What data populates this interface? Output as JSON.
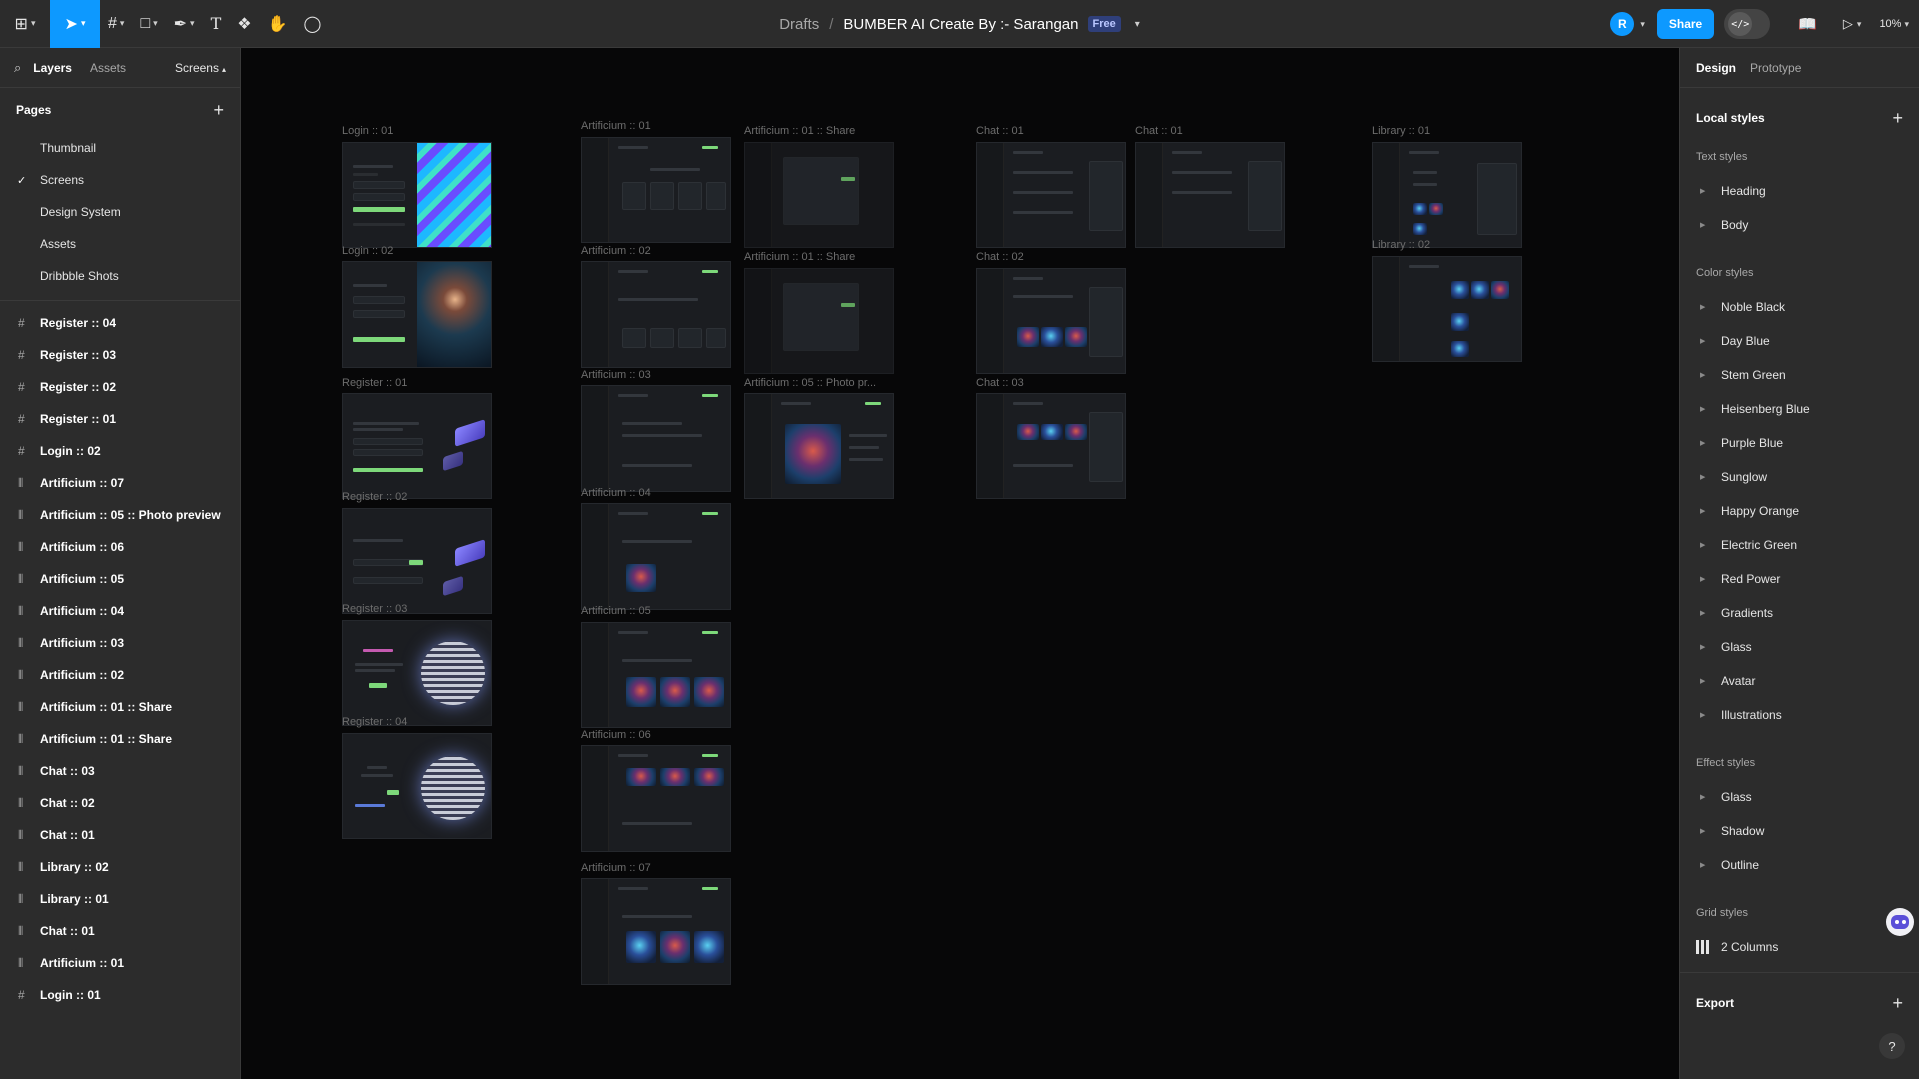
{
  "topbar": {
    "breadcrumb": "Drafts",
    "separator": "/",
    "file_name": "BUMBER AI Create By :- Sarangan",
    "plan_badge": "Free",
    "avatar_initial": "R",
    "share_label": "Share",
    "zoom": "10%",
    "accent_color": "#0d99ff",
    "tools": [
      "main-menu-icon",
      "move-icon",
      "frame-icon",
      "shape-icon",
      "pen-icon",
      "text-icon",
      "components-icon",
      "hand-icon",
      "comment-icon"
    ]
  },
  "left_panel": {
    "tabs": [
      "Layers",
      "Assets"
    ],
    "current_page_selector": "Screens",
    "pages_title": "Pages",
    "pages": [
      {
        "label": "Thumbnail",
        "selected": false
      },
      {
        "label": "Screens",
        "selected": true
      },
      {
        "label": "Design System",
        "selected": false
      },
      {
        "label": "Assets",
        "selected": false
      },
      {
        "label": "Dribbble Shots",
        "selected": false
      }
    ],
    "layers": [
      {
        "label": "Register :: 04",
        "icon": "frame-icon"
      },
      {
        "label": "Register :: 03",
        "icon": "frame-icon"
      },
      {
        "label": "Register :: 02",
        "icon": "frame-icon"
      },
      {
        "label": "Register :: 01",
        "icon": "frame-icon"
      },
      {
        "label": "Login :: 02",
        "icon": "frame-icon"
      },
      {
        "label": "Artificium :: 07",
        "icon": "column-layout-icon"
      },
      {
        "label": "Artificium :: 05 :: Photo preview",
        "icon": "column-layout-icon"
      },
      {
        "label": "Artificium :: 06",
        "icon": "column-layout-icon"
      },
      {
        "label": "Artificium :: 05",
        "icon": "column-layout-icon"
      },
      {
        "label": "Artificium :: 04",
        "icon": "column-layout-icon"
      },
      {
        "label": "Artificium :: 03",
        "icon": "column-layout-icon"
      },
      {
        "label": "Artificium :: 02",
        "icon": "column-layout-icon"
      },
      {
        "label": "Artificium :: 01 :: Share",
        "icon": "column-layout-icon"
      },
      {
        "label": "Artificium :: 01 :: Share",
        "icon": "column-layout-icon"
      },
      {
        "label": "Chat :: 03",
        "icon": "column-layout-icon"
      },
      {
        "label": "Chat :: 02",
        "icon": "column-layout-icon"
      },
      {
        "label": "Chat :: 01",
        "icon": "column-layout-icon"
      },
      {
        "label": "Library :: 02",
        "icon": "column-layout-icon"
      },
      {
        "label": "Library :: 01",
        "icon": "column-layout-icon"
      },
      {
        "label": "Chat :: 01",
        "icon": "column-layout-icon"
      },
      {
        "label": "Artificium :: 01",
        "icon": "column-layout-icon"
      },
      {
        "label": "Login :: 01",
        "icon": "frame-icon"
      }
    ]
  },
  "canvas": {
    "labels": {
      "login01": "Login :: 01",
      "login02": "Login :: 02",
      "register01": "Register :: 01",
      "register02": "Register :: 02",
      "register03": "Register :: 03",
      "register04": "Register :: 04",
      "art01": "Artificium :: 01",
      "art02": "Artificium :: 02",
      "art03": "Artificium :: 03",
      "art04": "Artificium :: 04",
      "art05": "Artificium :: 05",
      "art06": "Artificium :: 06",
      "art07": "Artificium :: 07",
      "share1": "Artificium :: 01 :: Share",
      "share2": "Artificium :: 01 :: Share",
      "photo": "Artificium :: 05 :: Photo pr...",
      "chat01": "Chat :: 01",
      "chat01b": "Chat :: 01",
      "chat02": "Chat :: 02",
      "chat03": "Chat :: 03",
      "lib01": "Library :: 01",
      "lib02": "Library :: 02"
    }
  },
  "right_panel": {
    "tabs": [
      "Design",
      "Prototype"
    ],
    "local_styles": "Local styles",
    "text_styles_title": "Text styles",
    "text_styles": [
      "Heading",
      "Body"
    ],
    "color_styles_title": "Color styles",
    "color_styles": [
      "Noble Black",
      "Day Blue",
      "Stem Green",
      "Heisenberg Blue",
      "Purple Blue",
      "Sunglow",
      "Happy Orange",
      "Electric Green",
      "Red Power",
      "Gradients",
      "Glass",
      "Avatar",
      "Illustrations"
    ],
    "effect_styles_title": "Effect styles",
    "effect_styles": [
      "Glass",
      "Shadow",
      "Outline"
    ],
    "grid_styles_title": "Grid styles",
    "grid_styles": [
      "2 Columns"
    ],
    "export_title": "Export",
    "help": "?"
  }
}
